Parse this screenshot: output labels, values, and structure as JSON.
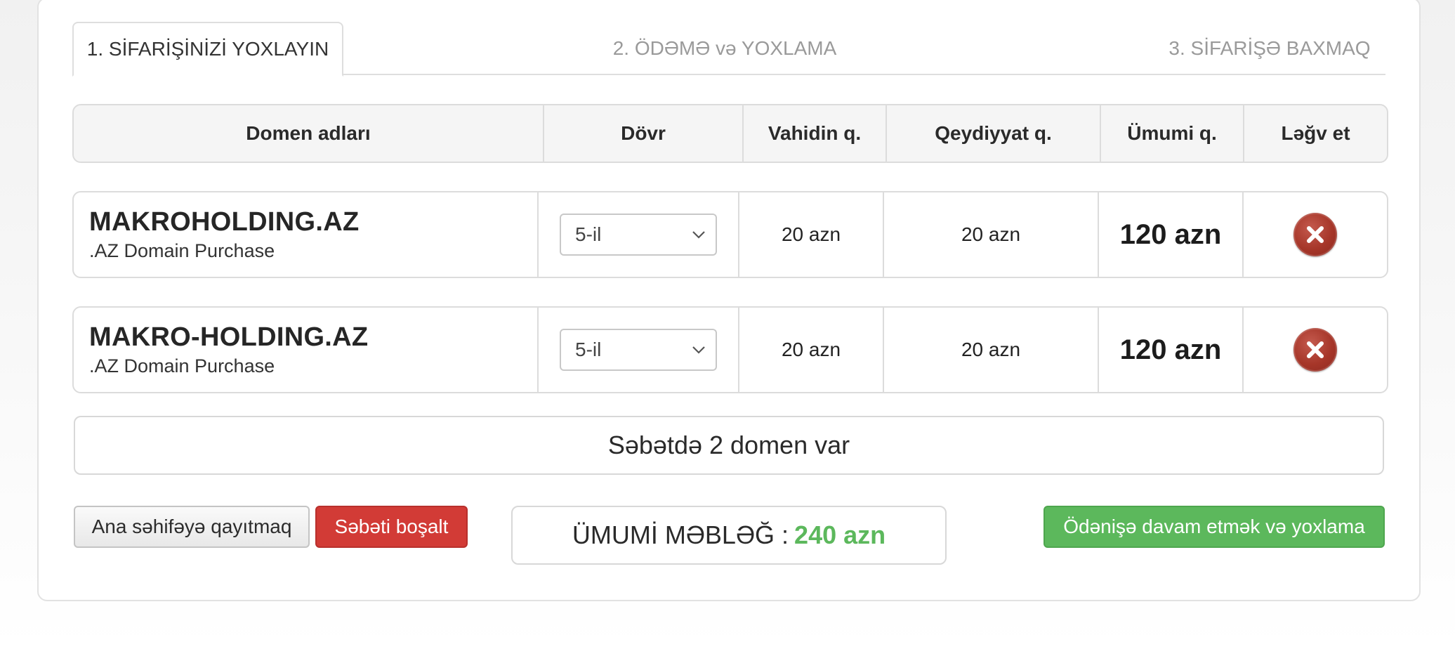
{
  "tabs": [
    {
      "label": "1. SİFARİŞİNİZİ YOXLAYIN",
      "active": true
    },
    {
      "label": "2. ÖDƏMƏ və YOXLAMA",
      "active": false
    },
    {
      "label": "3. SİFARİŞƏ BAXMAQ",
      "active": false
    }
  ],
  "table": {
    "headers": [
      "Domen adları",
      "Dövr",
      "Vahidin q.",
      "Qeydiyyat q.",
      "Ümumi q.",
      "Ləğv et"
    ],
    "rows": [
      {
        "domain": "MAKROHOLDING.AZ",
        "description": ".AZ Domain Purchase",
        "period": "5-il",
        "unit_price": "20 azn",
        "registration_price": "20 azn",
        "total": "120 azn"
      },
      {
        "domain": "MAKRO-HOLDING.AZ",
        "description": ".AZ Domain Purchase",
        "period": "5-il",
        "unit_price": "20 azn",
        "registration_price": "20 azn",
        "total": "120 azn"
      }
    ]
  },
  "summary": {
    "text": "Səbətdə 2 domen var"
  },
  "actions": {
    "back_label": "Ana səhifəyə qayıtmaq",
    "empty_label": "Səbəti boşalt",
    "pay_label": "Ödənişə davam etmək və yoxlama"
  },
  "grand_total": {
    "label": "ÜMUMİ MƏBLƏĞ :",
    "amount": "240 azn"
  },
  "colors": {
    "danger": "#d23b36",
    "success": "#5cb85c",
    "remove_icon": "#a63629"
  },
  "icons": {
    "remove": "close-circle-icon",
    "dropdown": "chevron-down-icon"
  }
}
